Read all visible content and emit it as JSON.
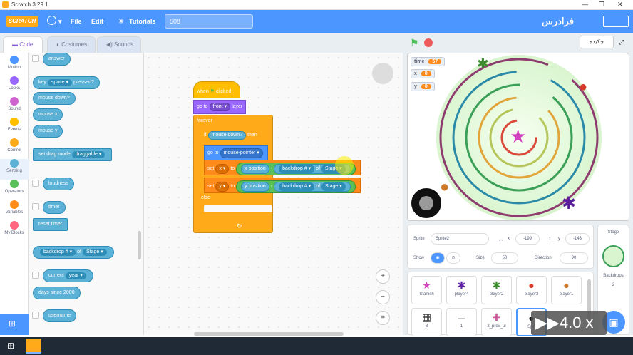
{
  "window": {
    "title": "Scratch 3.29.1"
  },
  "menu": {
    "logo": "SCRATCH",
    "file": "File",
    "edit": "Edit",
    "tutorials": "Tutorials",
    "project_title": "508",
    "brand_right": "فرادرس"
  },
  "tabs": {
    "code": "Code",
    "costumes": "Costumes",
    "sounds": "Sounds"
  },
  "categories": [
    {
      "label": "Motion",
      "color": "#4c97ff"
    },
    {
      "label": "Looks",
      "color": "#9966ff"
    },
    {
      "label": "Sound",
      "color": "#cf63cf"
    },
    {
      "label": "Events",
      "color": "#ffbf00"
    },
    {
      "label": "Control",
      "color": "#ffab19"
    },
    {
      "label": "Sensing",
      "color": "#5cb1d6"
    },
    {
      "label": "Operators",
      "color": "#59c059"
    },
    {
      "label": "Variables",
      "color": "#ff8c1a"
    },
    {
      "label": "My Blocks",
      "color": "#ff6680"
    }
  ],
  "palette": {
    "answer": "answer",
    "key": "key",
    "space": "space",
    "pressed": "pressed?",
    "mouse_down": "mouse down?",
    "mouse_x": "mouse x",
    "mouse_y": "mouse y",
    "set_drag": "set drag mode",
    "draggable": "draggable",
    "loudness": "loudness",
    "timer": "timer",
    "reset_timer": "reset timer",
    "backdrop_num": "backdrop #",
    "of": "of",
    "stage": "Stage",
    "current": "current",
    "year": "year",
    "days_since": "days since 2000",
    "username": "username"
  },
  "script": {
    "when_flag": "when",
    "clicked": "clicked",
    "go_to": "go to",
    "front": "front",
    "layer": "layer",
    "forever": "forever",
    "if": "if",
    "mouse_down": "mouse down?",
    "then": "then",
    "go_to2": "go to",
    "mouse_pointer": "mouse-pointer",
    "set": "set",
    "x": "x",
    "to": "to",
    "x_position": "x position",
    "minus": "-",
    "backdrop_num": "backdrop #",
    "of": "of",
    "stage": "Stage",
    "y": "y",
    "y_position": "y position",
    "else": "else"
  },
  "zoom": {
    "in": "+",
    "out": "−",
    "reset": "="
  },
  "stage": {
    "header_badge": "ﭼﮑﯿﺪﻩ",
    "monitors": [
      {
        "label": "time",
        "value": "57"
      },
      {
        "label": "x",
        "value": "0"
      },
      {
        "label": "y",
        "value": "0"
      }
    ]
  },
  "sprite_info": {
    "sprite_label": "Sprite",
    "sprite_name": "Sprite2",
    "x_label": "x",
    "x_value": "-199",
    "y_label": "y",
    "y_value": "-143",
    "show_label": "Show",
    "size_label": "Size",
    "size_value": "50",
    "direction_label": "Direction",
    "direction_value": "90"
  },
  "sprites": [
    {
      "name": "Starfish",
      "icon": "★"
    },
    {
      "name": "player4",
      "icon": "✱"
    },
    {
      "name": "player2",
      "icon": "✱"
    },
    {
      "name": "player3",
      "icon": "●"
    },
    {
      "name": "player1",
      "icon": "●"
    },
    {
      "name": "3",
      "icon": "▦"
    },
    {
      "name": "1",
      "icon": "═"
    },
    {
      "name": "2_prev_ui",
      "icon": "✚"
    },
    {
      "name": "Spri",
      "icon": "●"
    }
  ],
  "stage_pane": {
    "title": "Stage",
    "backdrops_label": "Backdrops",
    "backdrops_count": "2"
  },
  "overlay": {
    "speed": "4.0 x"
  }
}
